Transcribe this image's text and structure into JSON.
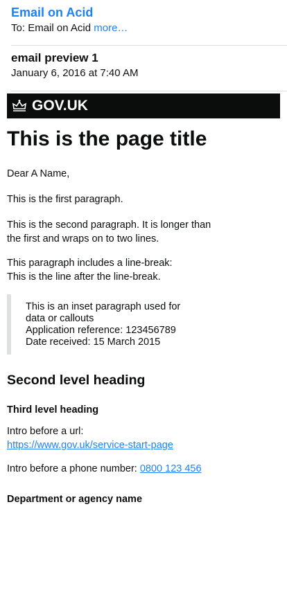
{
  "email_header": {
    "from": "Email on Acid",
    "to_label": "To:",
    "to": "Email on Acid",
    "more": "more…",
    "subject": "email preview 1",
    "date": "January 6, 2016 at 7:40 AM"
  },
  "banner": {
    "logo_text": "GOV.UK",
    "icon": "crown-icon"
  },
  "body": {
    "title": "This is the page title",
    "greeting": "Dear A Name,",
    "p1": "This is the first paragraph.",
    "p2": "This is the second paragraph. It is longer than the first and wraps on to two lines.",
    "p3_line1": "This paragraph includes a line-break:",
    "p3_line2": "This is the line after the line-break.",
    "inset": {
      "line1": "This is an inset paragraph used for data or callouts",
      "line2": "Application reference: 123456789",
      "line3": "Date received: 15 March 2015"
    },
    "h2": "Second level heading",
    "h3": "Third level heading",
    "url_intro": "Intro before a url:",
    "url": "https://www.gov.uk/service-start-page",
    "phone_intro": "Intro before a phone number:",
    "phone": "0800 123 456",
    "department": "Department or agency name"
  }
}
